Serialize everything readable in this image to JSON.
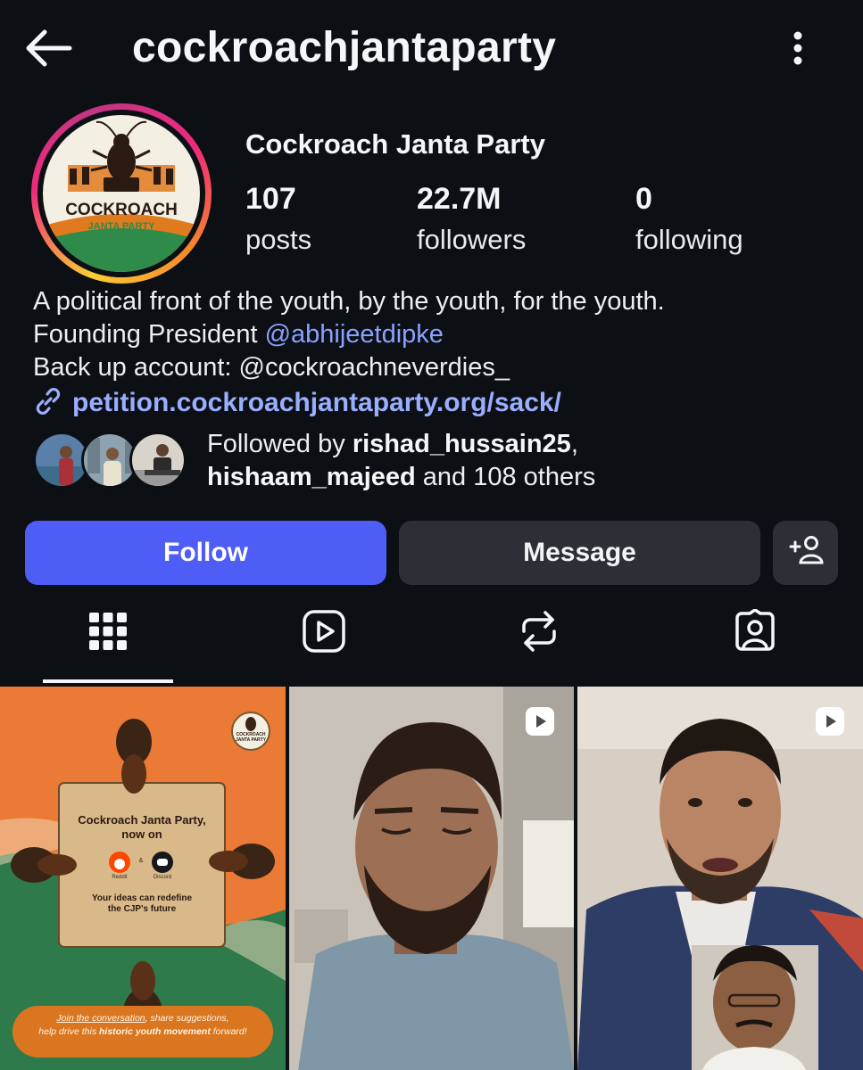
{
  "header": {
    "username": "cockroachjantaparty"
  },
  "profile": {
    "display_name": "Cockroach Janta Party",
    "avatar_text_top": "COCKROACH",
    "avatar_text_bottom": "JANTA PARTY",
    "stats": [
      {
        "value": "107",
        "label": "posts"
      },
      {
        "value": "22.7M",
        "label": "followers"
      },
      {
        "value": "0",
        "label": "following"
      }
    ],
    "bio": {
      "line1": "A political front of the youth, by the youth, for the youth.",
      "line2_prefix": "Founding President ",
      "line2_mention": "@abhijeetdipke",
      "line3": "Back up account: @cockroachneverdies_",
      "link": "petition.cockroachjantaparty.org/sack/"
    },
    "followed_by": {
      "prefix": "Followed by ",
      "user1": "rishad_hussain25",
      "sep": ",",
      "user2": "hishaam_majeed",
      "suffix": " and 108 others"
    }
  },
  "actions": {
    "follow": "Follow",
    "message": "Message"
  },
  "tabs": [
    "posts-grid",
    "reels",
    "reposts",
    "tagged"
  ],
  "posts": {
    "post1": {
      "title": "Cockroach Janta Party,",
      "title2": "now on",
      "reddit": "Reddit",
      "amp": "&",
      "discord": "Discord",
      "tagline1": "Your ideas can redefine",
      "tagline2": "the CJP's future",
      "badge_top": "COCKROACH",
      "badge_bottom": "JANTA PARTY",
      "footer1_a": "Join the conversation",
      "footer1_b": ", share suggestions,",
      "footer2_a": "help drive this ",
      "footer2_b": "historic youth movement",
      "footer2_c": " forward!"
    }
  },
  "colors": {
    "background": "#0c0f14",
    "follow_button": "#4f5df7",
    "secondary_button": "#2c2f36",
    "link": "#9aaeff",
    "post1_orange": "#ea7a35",
    "post1_green": "#2f7a4a"
  }
}
